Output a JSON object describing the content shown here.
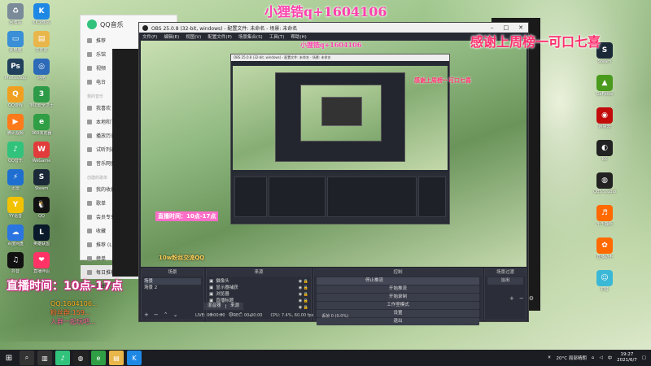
{
  "overlays": {
    "qq_contact": "小狸锆q+1604106",
    "thanks": "感谢上周榜一可口七喜",
    "live_time": "直播时间：10点-17点",
    "fans_group": "10w粉丝交流QQ",
    "chat_lines": [
      "QQ:1604106...",
      "粉丝群:159...",
      "入群一起玩吧..."
    ]
  },
  "desktop_icons_left": [
    {
      "label": "回收站",
      "color": "#7a8a99",
      "glyph": "♻"
    },
    {
      "label": "KK录像机",
      "color": "#1e88e5",
      "glyph": "K"
    },
    {
      "label": "此电脑",
      "color": "#3a8fd6",
      "glyph": "▭"
    },
    {
      "label": "文件夹",
      "color": "#e8b64a",
      "glyph": "▤"
    },
    {
      "label": "Photoshop",
      "color": "#21405c",
      "glyph": "Ps"
    },
    {
      "label": "网络",
      "color": "#2d6bb8",
      "glyph": "◎"
    },
    {
      "label": "QQ游戏",
      "color": "#f0a020",
      "glyph": "Q"
    },
    {
      "label": "360安全卫士",
      "color": "#2d9a48",
      "glyph": "3"
    },
    {
      "label": "腾讯视频",
      "color": "#ff7a1a",
      "glyph": "▶"
    },
    {
      "label": "360浏览器",
      "color": "#2f9e44",
      "glyph": "e"
    },
    {
      "label": "QQ音乐",
      "color": "#31c27c",
      "glyph": "♪"
    },
    {
      "label": "WeGame",
      "color": "#e23b3b",
      "glyph": "W"
    },
    {
      "label": "迅雷",
      "color": "#1f6fd1",
      "glyph": "⚡"
    },
    {
      "label": "Steam",
      "color": "#1b2838",
      "glyph": "S"
    },
    {
      "label": "YY语音",
      "color": "#f2c200",
      "glyph": "Y"
    },
    {
      "label": "QQ",
      "color": "#111",
      "glyph": "🐧"
    },
    {
      "label": "百度网盘",
      "color": "#2a75e0",
      "glyph": "☁"
    },
    {
      "label": "英雄联盟",
      "color": "#0a1a2a",
      "glyph": "L"
    },
    {
      "label": "抖音",
      "color": "#111",
      "glyph": "♫"
    },
    {
      "label": "直播伴侣",
      "color": "#ff3366",
      "glyph": "❤"
    }
  ],
  "desktop_icons_right": [
    {
      "label": "Steam",
      "color": "#1b2838",
      "glyph": "S"
    },
    {
      "label": "GeForce",
      "color": "#4a9a1e",
      "glyph": "▲"
    },
    {
      "label": "网易云",
      "color": "#c20c0c",
      "glyph": "◉"
    },
    {
      "label": "KK",
      "color": "#222",
      "glyph": "◐"
    },
    {
      "label": "OBS Studio",
      "color": "#222",
      "glyph": "◍"
    },
    {
      "label": "千千静听",
      "color": "#ff6a00",
      "glyph": "♬"
    },
    {
      "label": "直播助手",
      "color": "#ff6a00",
      "glyph": "✿"
    },
    {
      "label": "初音",
      "color": "#3bb8d6",
      "glyph": "☺"
    }
  ],
  "qq_music": {
    "title": "QQ音乐",
    "items_top": [
      "推荐",
      "乐馆",
      "视频",
      "电台"
    ],
    "section_label": "我的音乐",
    "items_mid": [
      "我喜欢",
      "本地和下载",
      "播放历史",
      "试听列表",
      "音乐网盘"
    ],
    "section_label_2": "创建的歌单",
    "items_bottom": [
      "我的收藏",
      "歌单",
      "会员专享",
      "收藏",
      "推荐 (Live)",
      "榜单",
      "每日推荐",
      "歌曲"
    ]
  },
  "obs": {
    "titlebar": "OBS 25.0.8 (32-bit, windows) - 配置文件: 未命名 - 场景: 未命名",
    "menu": [
      "文件(F)",
      "编辑(E)",
      "视图(V)",
      "配置文件(P)",
      "场景集合(S)",
      "工具(T)",
      "帮助(H)"
    ],
    "docks": {
      "scenes_title": "场景",
      "scenes": [
        "场景",
        "场景 2"
      ],
      "sources_title": "来源",
      "sources": [
        "摄像头",
        "显示器捕获",
        "浏览器",
        "直播标题",
        "窗口捕获 2"
      ],
      "controls_title": "控制",
      "controls": [
        "开始推流",
        "开始录制",
        "工作室模式",
        "设置",
        "退出"
      ],
      "controls_dropdown": "停止推流",
      "transitions_title": "场景过渡",
      "transition": "淡出",
      "source_tabs": [
        "混音器",
        "来源"
      ]
    },
    "status": {
      "live": "LIVE: 00:00:00",
      "rec": "REC: 00:00:00",
      "cpu": "CPU: 7.4%, 60.00 fps",
      "dropped": "丢帧 0 (0.0%)"
    }
  },
  "taskbar": {
    "weather": "20°C 局部晴朗",
    "lang": "中",
    "time": "19:27",
    "date": "2021/6/7",
    "apps": [
      {
        "name": "start",
        "color": "#1c1d22",
        "glyph": "⊞"
      },
      {
        "name": "search",
        "color": "#333",
        "glyph": "⌕"
      },
      {
        "name": "taskview",
        "color": "#333",
        "glyph": "▥"
      },
      {
        "name": "qqmusic",
        "color": "#31c27c",
        "glyph": "♪"
      },
      {
        "name": "obs",
        "color": "#222",
        "glyph": "◍"
      },
      {
        "name": "browser",
        "color": "#2f9e44",
        "glyph": "e"
      },
      {
        "name": "explorer",
        "color": "#e8b64a",
        "glyph": "▤"
      },
      {
        "name": "kk",
        "color": "#1e88e5",
        "glyph": "K"
      }
    ]
  },
  "colors": {
    "obs_bg": "#272a33",
    "overlay_pink": "#ff3fae",
    "accent_green": "#31c27c"
  }
}
